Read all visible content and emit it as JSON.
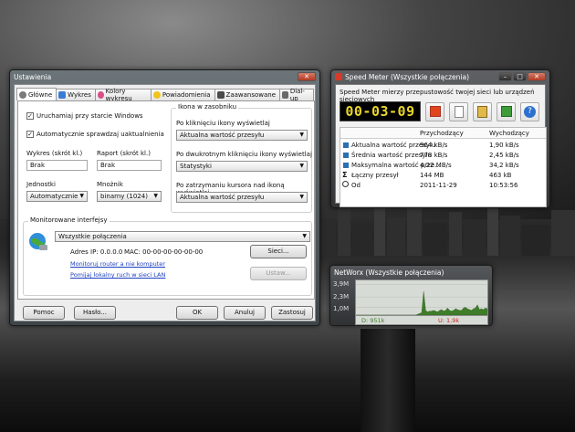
{
  "settings": {
    "title": "Ustawienia",
    "tabs": [
      {
        "label": "Główne",
        "icon": "gear-icon",
        "color": "#7a7a7a"
      },
      {
        "label": "Wykres",
        "icon": "chart-icon",
        "color": "#3a7bd5"
      },
      {
        "label": "Kolory wykresu",
        "icon": "palette-icon",
        "color": "#d94f8a"
      },
      {
        "label": "Powiadomienia",
        "icon": "bulb-icon",
        "color": "#f0c419"
      },
      {
        "label": "Zaawansowane",
        "icon": "advanced-icon",
        "color": "#4a4a4a"
      },
      {
        "label": "Dial-up",
        "icon": "phone-icon",
        "color": "#6a6a6a"
      }
    ],
    "startup_label": "Uruchamiaj przy starcie Windows",
    "startup_checked": true,
    "updates_label": "Automatycznie sprawdzaj uaktualnienia",
    "updates_checked": true,
    "graph_shortcut_label": "Wykres (skrót kl.)",
    "graph_shortcut_value": "Brak",
    "report_shortcut_label": "Raport (skrót kl.)",
    "report_shortcut_value": "Brak",
    "units_label": "Jednostki",
    "units_value": "Automatycznie",
    "multiplier_label": "Mnożnik",
    "multiplier_value": "binarny (1024)",
    "tray_group_title": "Ikona w zasobniku",
    "tray_click_label": "Po kliknięciu ikony wyświetlaj",
    "tray_click_value": "Aktualna wartość przesyłu",
    "tray_dblclick_label": "Po dwukrotnym kliknięciu ikony wyświetlaj",
    "tray_dblclick_value": "Statystyki",
    "tray_hover_label": "Po zatrzymaniu kursora nad ikoną wyświetlaj",
    "tray_hover_value": "Aktualna wartość przesyłu",
    "iface_group_title": "Monitorowane interfejsy",
    "iface_value": "Wszystkie połączenia",
    "ip_label": "Adres IP: 0.0.0.0",
    "mac_label": "MAC: 00-00-00-00-00-00",
    "link_router": "Monitoruj router a nie komputer",
    "link_lan": "Pomijaj lokalny ruch w sieci LAN",
    "networks_button": "Sieci...",
    "setup_button": "Ustaw...",
    "help_button": "Pomoc",
    "password_button": "Hasło...",
    "ok_button": "OK",
    "cancel_button": "Anuluj",
    "apply_button": "Zastosuj"
  },
  "speedmeter": {
    "title": "Speed Meter (Wszystkie połączenia)",
    "description": "Speed Meter mierzy przepustowość twojej sieci lub urządzeń sieciowych",
    "timer": "00-03-09",
    "col_incoming": "Przychodzący",
    "col_outgoing": "Wychodzący",
    "rows": [
      {
        "label": "Aktualna wartość przesyłu",
        "icon": "bar-icon",
        "in": "964 kB/s",
        "out": "1,90 kB/s"
      },
      {
        "label": "Średnia wartość przesyłu",
        "icon": "bar-icon",
        "in": "778 kB/s",
        "out": "2,45 kB/s"
      },
      {
        "label": "Maksymalna wartość prze...",
        "icon": "bar-icon",
        "in": "4,22 MB/s",
        "out": "34,2 kB/s"
      },
      {
        "label": "Łączny przesył",
        "icon": "sigma-icon",
        "in": "144 MB",
        "out": "463 kB"
      },
      {
        "label": "Od",
        "icon": "clock-icon",
        "in": "2011-11-29",
        "out": "10:53:56"
      }
    ]
  },
  "networx": {
    "title": "NetWorx (Wszystkie połączenia)",
    "y_labels": [
      "3,9M",
      "2,3M",
      "1,0M"
    ],
    "download_label": "D: 951k",
    "upload_label": "U: 1,9k",
    "download_color": "#3f7d2a",
    "upload_color": "#c62828"
  },
  "chart_data": {
    "type": "area",
    "title": "NetWorx (Wszystkie połączenia)",
    "ylabel": "",
    "xlabel": "",
    "y_ticks": [
      "1,0M",
      "2,3M",
      "3,9M"
    ],
    "ylim": [
      0,
      4.4
    ],
    "series": [
      {
        "name": "D: 951k",
        "values": [
          0,
          0,
          0,
          0,
          0,
          0,
          0,
          0,
          0,
          0,
          0,
          0,
          0,
          0,
          0,
          0,
          0,
          0,
          0,
          0,
          0,
          0,
          0,
          0,
          0,
          0,
          0,
          0,
          0,
          0,
          0,
          0.1,
          0.2,
          0.3,
          3.0,
          0.6,
          0.4,
          0.5,
          0.5,
          0.6,
          0.5,
          0.4,
          0.6,
          0.7,
          0.5,
          0.6,
          0.9,
          0.6,
          0.5,
          0.6,
          0.8,
          0.7,
          0.6,
          0.6,
          0.9,
          1.0,
          0.8,
          0.7,
          0.6,
          0.8,
          0.9,
          1.3,
          0.7,
          0.8,
          0.7,
          0.9,
          0.8
        ]
      }
    ]
  }
}
